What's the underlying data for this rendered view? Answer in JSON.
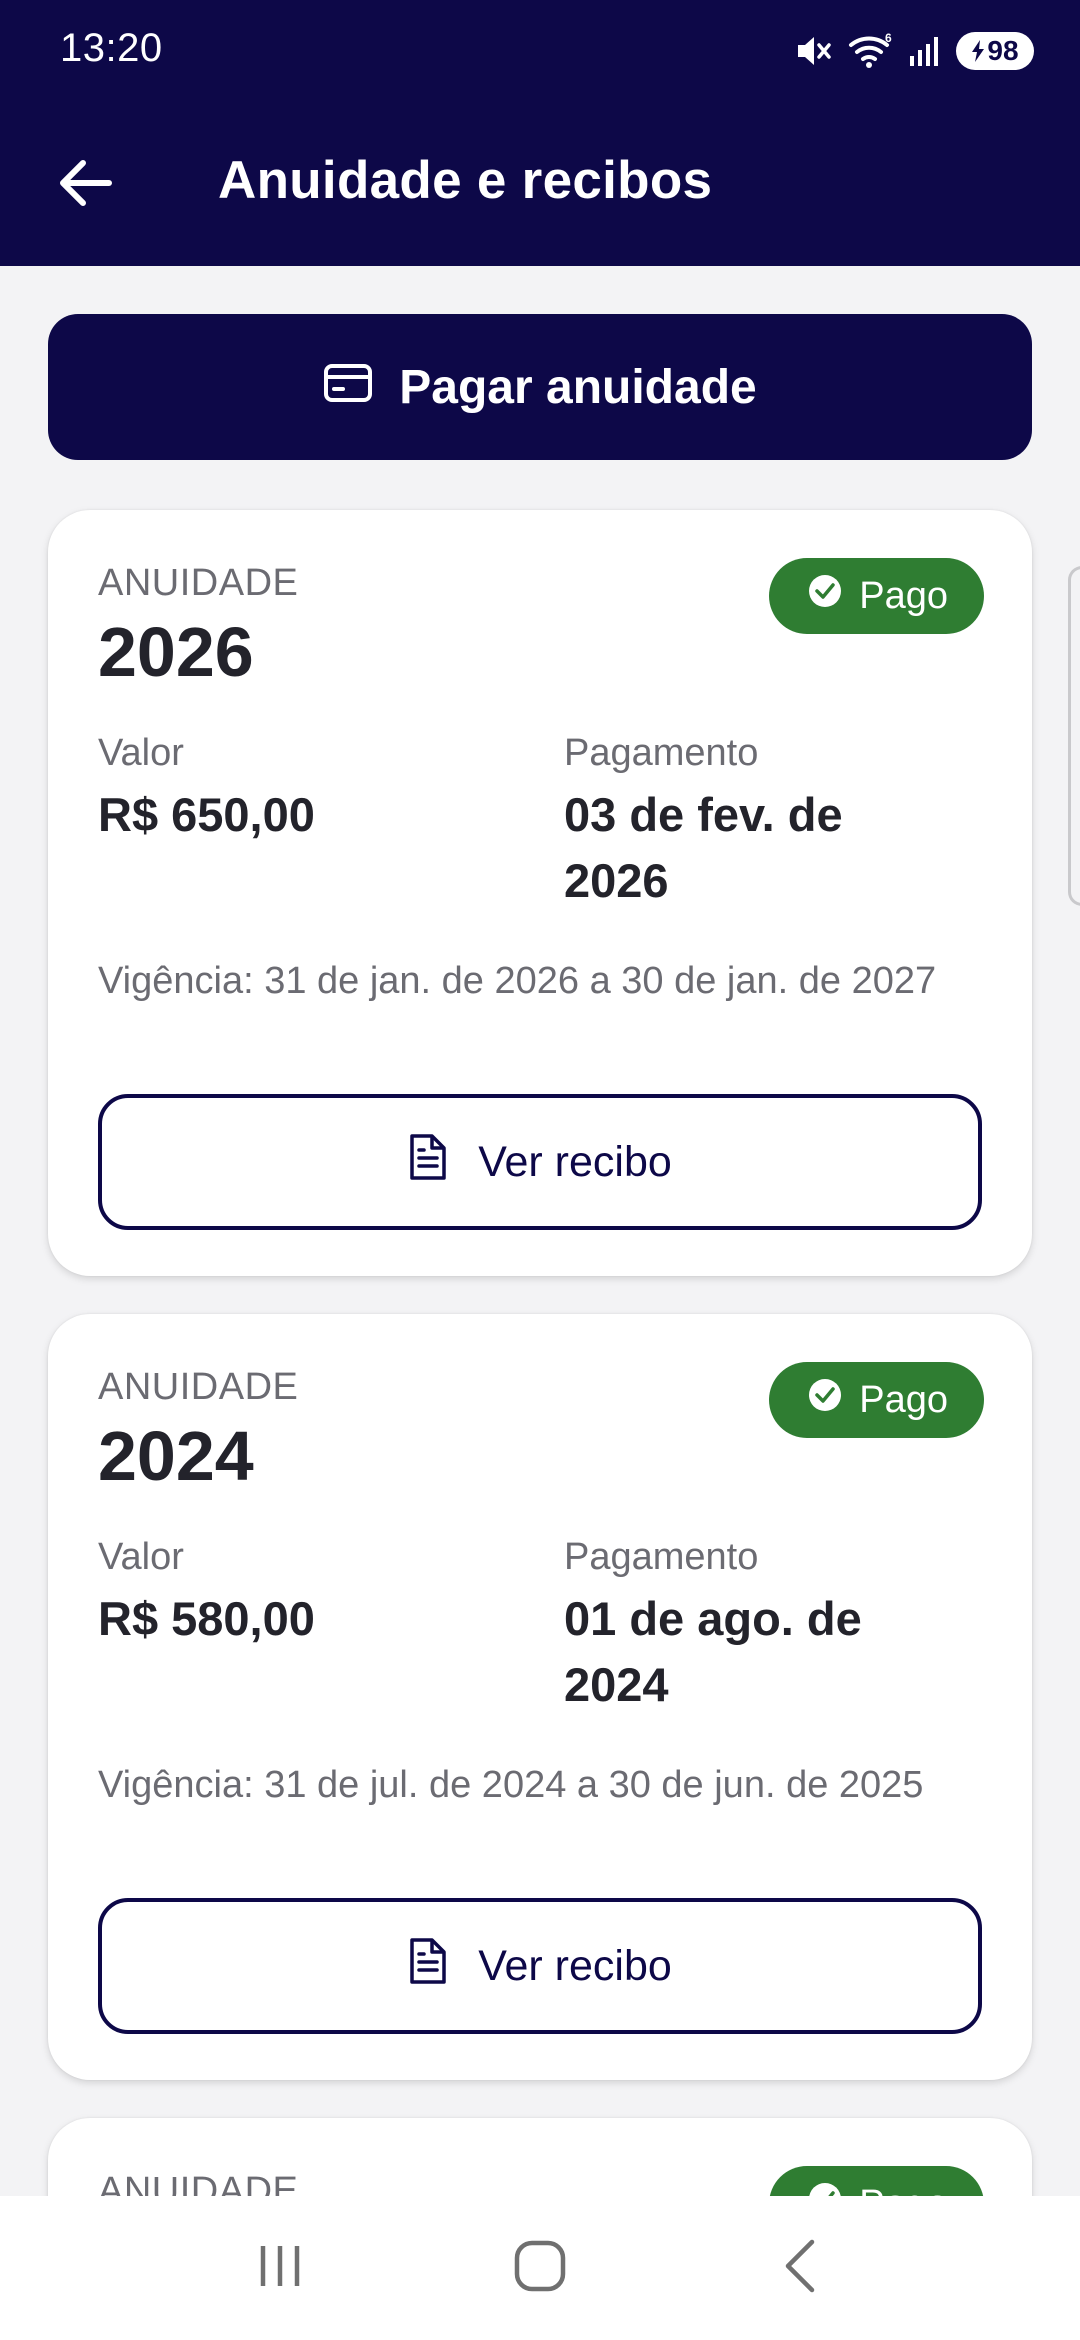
{
  "status_bar": {
    "time": "13:20",
    "battery": "98"
  },
  "app_bar": {
    "title": "Anuidade e recibos"
  },
  "pay_button": {
    "label": "Pagar anuidade"
  },
  "cards": [
    {
      "kicker": "ANUIDADE",
      "year": "2026",
      "status": "Pago",
      "value_label": "Valor",
      "value": "R$ 650,00",
      "payment_label": "Pagamento",
      "payment_date": "03 de fev. de 2026",
      "validity": "Vigência: 31 de jan. de 2026 a 30 de jan. de 2027",
      "receipt_label": "Ver recibo"
    },
    {
      "kicker": "ANUIDADE",
      "year": "2024",
      "status": "Pago",
      "value_label": "Valor",
      "value": "R$ 580,00",
      "payment_label": "Pagamento",
      "payment_date": "01 de ago. de 2024",
      "validity": "Vigência: 31 de jul. de 2024 a 30 de jun. de 2025",
      "receipt_label": "Ver recibo"
    },
    {
      "kicker": "ANUIDADE",
      "status": "Pago"
    }
  ],
  "colors": {
    "primary": "#0d0848",
    "success": "#2f7d32",
    "background": "#f3f3f5"
  }
}
